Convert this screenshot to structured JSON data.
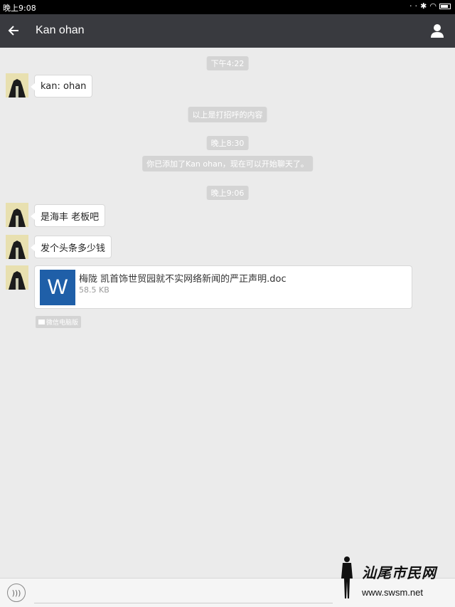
{
  "status_bar": {
    "time": "晚上9:08"
  },
  "header": {
    "title": "Kan    ohan"
  },
  "messages": {
    "time_1": "下午4:22",
    "msg_1": "kan:    ohan",
    "system_1": "以上是打招呼的内容",
    "time_2": "晚上8:30",
    "system_2": "你已添加了Kan    ohan，现在可以开始聊天了。",
    "time_3": "晚上9:06",
    "msg_2": "是海丰      老板吧",
    "msg_3": "发个头条多少钱",
    "file": {
      "icon_letter": "W",
      "name": "梅陇   凯首饰世贸园就不实网络新闻的严正声明.doc",
      "size": "58.5 KB"
    },
    "mini_tag": "微信电脑版"
  },
  "watermark": {
    "text": "汕尾市民网",
    "url": "www.swsm.net"
  },
  "colors": {
    "title_bar": "#393a3f",
    "chat_bg": "#ebebeb",
    "word_icon": "#1f5fa8"
  }
}
